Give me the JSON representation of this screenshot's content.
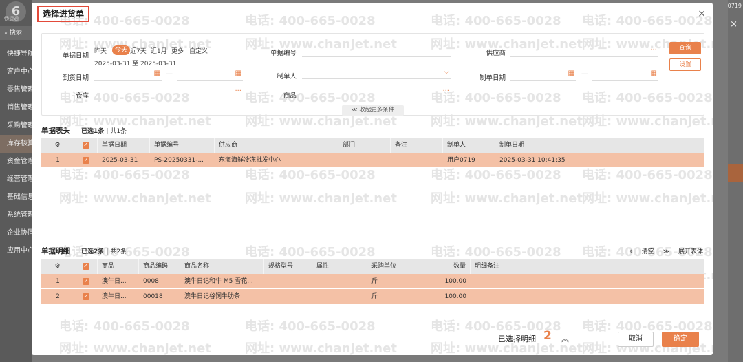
{
  "background": {
    "brand": "畅捷通",
    "search_label": "搜索",
    "menu": [
      "快捷导航",
      "客户中心",
      "零售管理",
      "销售管理",
      "采购管理",
      "库存核算",
      "资金管理",
      "经营管理",
      "基础信息",
      "系统管理",
      "企业协同",
      "应用中心"
    ],
    "active_index": 5,
    "right_text": "0719"
  },
  "modal": {
    "title": "选择进货单",
    "close": "×"
  },
  "filter": {
    "doc_date_label": "单据日期",
    "date_options": [
      "昨天",
      "今天",
      "近7天",
      "近1月",
      "更多",
      "自定义"
    ],
    "selected_date_option": 1,
    "date_range": "2025-03-31 至 2025-03-31",
    "arrival_date_label": "到货日期",
    "warehouse_label": "仓库",
    "doc_no_label": "单据编号",
    "maker_label": "制单人",
    "product_label": "商品",
    "supplier_label": "供应商",
    "make_date_label": "制单日期",
    "query_button": "查询",
    "settings_button": "设置",
    "collapse_label": "收起更多条件",
    "ellipsis": "···",
    "dash": "—"
  },
  "header_section": {
    "title": "单据表头",
    "selected_text": "已选",
    "selected_count": "1",
    "total_text": "| 共1条",
    "columns": [
      "",
      "",
      "单据日期",
      "单据编号",
      "供应商",
      "部门",
      "备注",
      "制单人",
      "制单日期"
    ],
    "rows": [
      {
        "index": "1",
        "date": "2025-03-31",
        "doc_no": "PS-20250331-...",
        "supplier": "东海海鲜冷冻批发中心",
        "dept": "",
        "note": "",
        "maker": "用户0719",
        "make_date": "2025-03-31 10:41:35"
      }
    ]
  },
  "detail_section": {
    "title": "单据明细",
    "selected_text": "已选",
    "selected_count": "2",
    "total_text": "| 共2条",
    "clear_label": "清空",
    "expand_label": "展开表体",
    "columns": [
      "",
      "",
      "商品",
      "商品编码",
      "商品名称",
      "规格型号",
      "属性",
      "采购单位",
      "数量",
      "明细备注"
    ],
    "rows": [
      {
        "index": "1",
        "product": "澳牛日...",
        "code": "0008",
        "name": "澳牛日记和牛 M5 雪花...",
        "spec": "",
        "attr": "",
        "unit": "斤",
        "qty": "100.00",
        "note": ""
      },
      {
        "index": "2",
        "product": "澳牛日...",
        "code": "00018",
        "name": "澳牛日记谷饲牛肋条",
        "spec": "",
        "attr": "",
        "unit": "斤",
        "qty": "100.00",
        "note": ""
      }
    ]
  },
  "footer": {
    "selected_label": "已选择明细",
    "selected_count": "2",
    "cancel_button": "取消",
    "ok_button": "确定"
  },
  "watermark": {
    "phone": "电话: 400-665-0028",
    "site": "网址: www.chanjet.net"
  },
  "colors": {
    "accent": "#e9814b",
    "selected_row": "#f4c1a6",
    "title_border": "#e34a3a"
  }
}
